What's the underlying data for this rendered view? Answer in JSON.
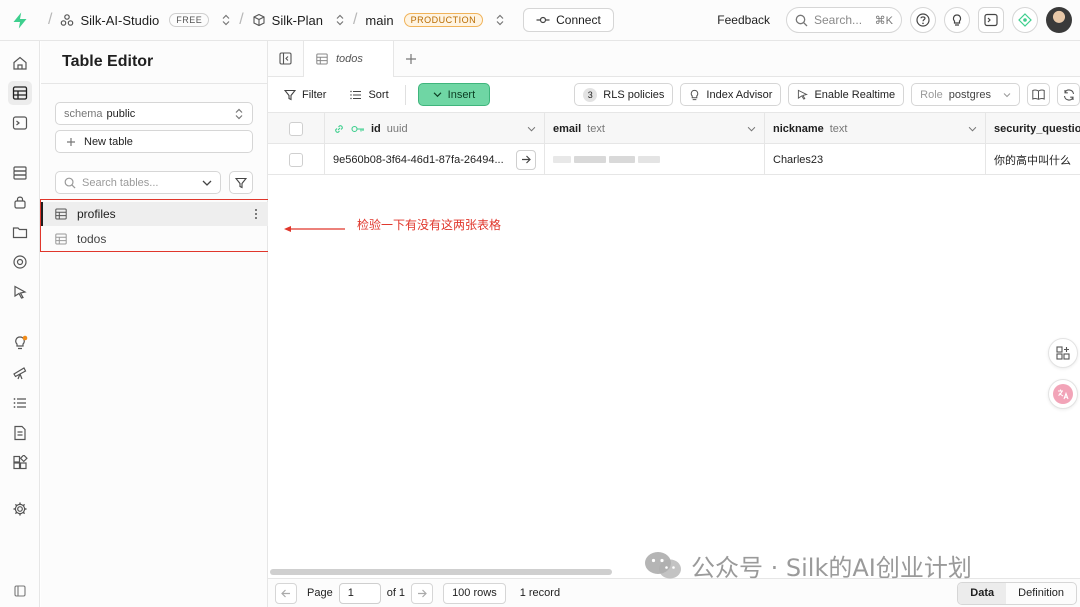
{
  "topbar": {
    "org": "Silk-AI-Studio",
    "org_badge": "FREE",
    "project": "Silk-Plan",
    "branch": "main",
    "branch_badge": "PRODUCTION",
    "connect_label": "Connect",
    "feedback_label": "Feedback",
    "search_placeholder": "Search...",
    "search_shortcut": "⌘K"
  },
  "sidebar": {
    "title": "Table Editor",
    "schema_label": "schema",
    "schema_value": "public",
    "new_table_label": "New table",
    "search_placeholder": "Search tables...",
    "tables": [
      {
        "name": "profiles"
      },
      {
        "name": "todos"
      }
    ]
  },
  "tabs": [
    {
      "label": "todos"
    }
  ],
  "toolbar": {
    "filter_label": "Filter",
    "sort_label": "Sort",
    "insert_label": "Insert",
    "rls_count": "3",
    "rls_label": "RLS policies",
    "index_advisor_label": "Index Advisor",
    "realtime_label": "Enable Realtime",
    "role_key": "Role",
    "role_value": "postgres"
  },
  "grid": {
    "columns": [
      {
        "name": "id",
        "type": "uuid"
      },
      {
        "name": "email",
        "type": "text"
      },
      {
        "name": "nickname",
        "type": "text"
      },
      {
        "name": "security_questio",
        "type": ""
      }
    ],
    "rows": [
      {
        "id": "9e560b08-3f64-46d1-87fa-26494...",
        "email": "",
        "nickname": "Charles23",
        "security_question": "你的高中叫什么"
      }
    ]
  },
  "annotation": {
    "text": "检验一下有没有这两张表格"
  },
  "footer": {
    "page_label": "Page",
    "page_value": "1",
    "of_label": "of 1",
    "rows_label": "100 rows",
    "record_count": "1 record",
    "data_tab": "Data",
    "definition_tab": "Definition"
  },
  "watermark": {
    "text": "公众号 · Silk的AI创业计划"
  },
  "colors": {
    "accent_green": "#3ecf8e",
    "insert_bg": "#6fd6a4",
    "annotation_red": "#e0362b",
    "production_orange": "#b86b00"
  }
}
